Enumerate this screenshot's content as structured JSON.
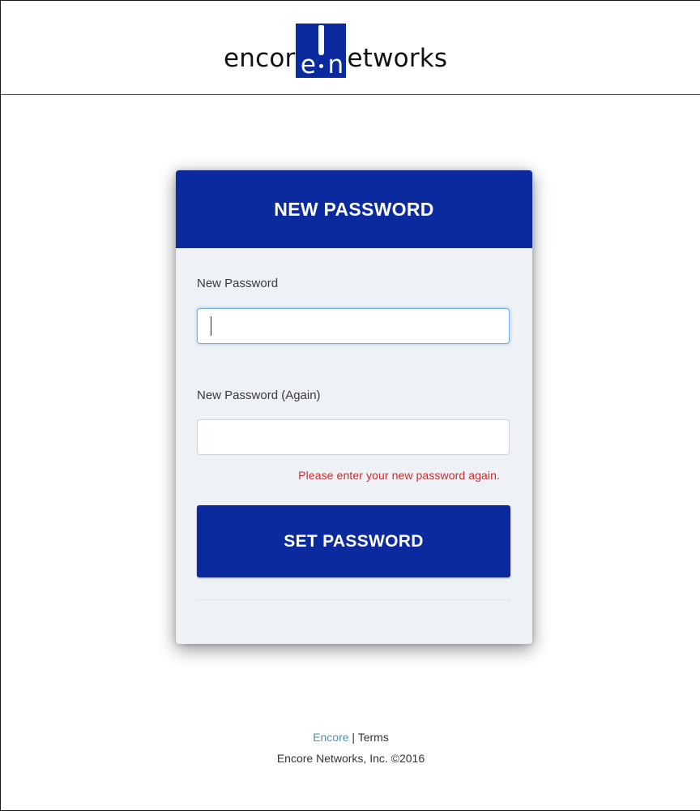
{
  "brand": {
    "logo_left": "encor",
    "logo_box_e": "e",
    "logo_box_n": "n",
    "logo_right": "etworks",
    "colors": {
      "primary": "#0b2a9e",
      "error": "#cc2b2b",
      "link": "#4a90b8"
    }
  },
  "card": {
    "title": "NEW PASSWORD",
    "fields": {
      "new_password": {
        "label": "New Password",
        "value": "",
        "focused": true
      },
      "new_password_again": {
        "label": "New Password (Again)",
        "value": ""
      }
    },
    "error_message": "Please enter your new password again.",
    "submit_label": "SET PASSWORD"
  },
  "footer": {
    "link_encore": "Encore",
    "separator": "|",
    "link_terms": "Terms",
    "copyright": "Encore Networks, Inc. ©2016"
  }
}
